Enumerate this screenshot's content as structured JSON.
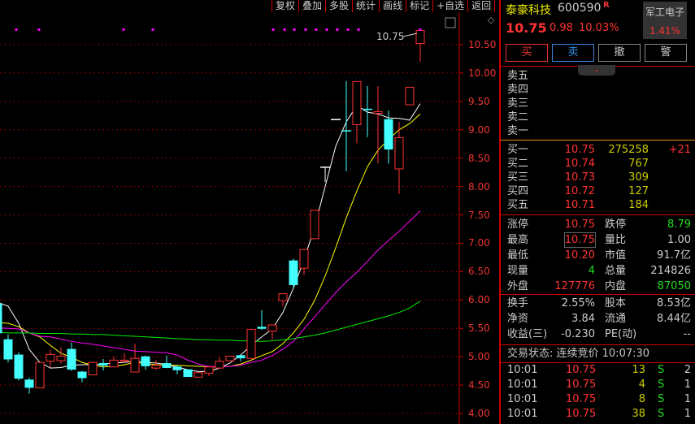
{
  "toolbar": [
    "复权",
    "叠加",
    "多股",
    "统计",
    "画线",
    "标记",
    "+自选",
    "返回"
  ],
  "stock": {
    "name": "泰豪科技",
    "code": "600590",
    "badge": "R",
    "price": "10.75",
    "change": "0.98",
    "pct": "10.03%",
    "sector": "军工电子",
    "sector_pct": "1.41%"
  },
  "trade_buttons": [
    "买",
    "卖",
    "撤",
    "警"
  ],
  "asks": [
    "卖五",
    "卖四",
    "卖三",
    "卖二",
    "卖一"
  ],
  "bids": [
    {
      "label": "买一",
      "price": "10.75",
      "vol": "275258",
      "delta": "+21"
    },
    {
      "label": "买二",
      "price": "10.74",
      "vol": "767"
    },
    {
      "label": "买三",
      "price": "10.73",
      "vol": "309"
    },
    {
      "label": "买四",
      "price": "10.72",
      "vol": "127"
    },
    {
      "label": "买五",
      "price": "10.71",
      "vol": "184"
    }
  ],
  "stats": [
    {
      "l1": "涨停",
      "v1": "10.75",
      "l2": "跌停",
      "v2": "8.79"
    },
    {
      "l1": "最高",
      "v1": "10.75",
      "l2": "量比",
      "v2": "1.00"
    },
    {
      "l1": "最低",
      "v1": "10.20",
      "l2": "市值",
      "v2": "91.7亿"
    },
    {
      "l1": "现量",
      "v1": "4",
      "l2": "总量",
      "v2": "214826"
    },
    {
      "l1": "外盘",
      "v1": "127776",
      "l2": "内盘",
      "v2": "87050"
    }
  ],
  "fund": [
    {
      "l1": "换手",
      "v1": "2.55%",
      "l2": "股本",
      "v2": "8.53亿"
    },
    {
      "l1": "净资",
      "v1": "3.84",
      "l2": "流通",
      "v2": "8.44亿"
    },
    {
      "l1": "收益(三)",
      "v1": "-0.230",
      "l2": "PE(动)",
      "v2": "--"
    }
  ],
  "status": "交易状态: 连续竞价 10:07:30",
  "ticks": [
    {
      "t": "10:01",
      "p": "10.75",
      "v": "13",
      "s": "S",
      "n": "2"
    },
    {
      "t": "10:01",
      "p": "10.75",
      "v": "4",
      "s": "S",
      "n": "1"
    },
    {
      "t": "10:01",
      "p": "10.75",
      "v": "8",
      "s": "S",
      "n": "1"
    },
    {
      "t": "10:01",
      "p": "10.75",
      "v": "38",
      "s": "S",
      "n": "1"
    }
  ],
  "chart_data": {
    "type": "candlestick",
    "last_label": "10.75",
    "y_ticks": [
      "10.50",
      "10.00",
      "9.50",
      "9.00",
      "8.50",
      "8.00",
      "7.50",
      "7.00",
      "6.50",
      "6.00",
      "5.50",
      "5.00",
      "4.50",
      "4.00"
    ],
    "ylim": [
      4.0,
      10.5
    ],
    "candles": [
      [
        5.93,
        5.96,
        5.42,
        5.42
      ],
      [
        5.3,
        5.39,
        4.9,
        4.96
      ],
      [
        5.03,
        5.08,
        4.58,
        4.62
      ],
      [
        4.59,
        4.63,
        4.35,
        4.46
      ],
      [
        4.45,
        4.9,
        4.45,
        4.9
      ],
      [
        4.92,
        5.12,
        4.81,
        5.04
      ],
      [
        4.93,
        5.17,
        4.88,
        5.01
      ],
      [
        5.13,
        5.25,
        4.75,
        4.78
      ],
      [
        4.73,
        4.75,
        4.55,
        4.63
      ],
      [
        4.68,
        4.9,
        4.68,
        4.9
      ],
      [
        4.88,
        4.96,
        4.76,
        4.85
      ],
      [
        4.82,
        5.0,
        4.82,
        4.94
      ],
      [
        4.92,
        5.06,
        4.9,
        4.94
      ],
      [
        4.73,
        5.23,
        4.73,
        4.97
      ],
      [
        5.0,
        5.02,
        4.77,
        4.84
      ],
      [
        4.8,
        4.94,
        4.77,
        4.85
      ],
      [
        4.88,
        5.02,
        4.8,
        4.81
      ],
      [
        4.82,
        4.85,
        4.69,
        4.77
      ],
      [
        4.77,
        4.77,
        4.65,
        4.65
      ],
      [
        4.64,
        4.72,
        4.64,
        4.72
      ],
      [
        4.71,
        4.84,
        4.66,
        4.82
      ],
      [
        4.8,
        4.99,
        4.8,
        4.92
      ],
      [
        4.93,
        5.01,
        4.93,
        5.01
      ],
      [
        5.02,
        5.02,
        4.92,
        4.98
      ],
      [
        4.97,
        5.48,
        4.97,
        5.48
      ],
      [
        5.52,
        5.82,
        5.47,
        5.5
      ],
      [
        5.45,
        5.57,
        5.3,
        5.56
      ],
      [
        5.99,
        6.11,
        5.89,
        6.11
      ],
      [
        6.69,
        6.73,
        6.21,
        6.27
      ],
      [
        6.56,
        6.89,
        6.44,
        6.89
      ],
      [
        7.08,
        7.58,
        7.08,
        7.58
      ],
      [
        8.34,
        8.34,
        8.08,
        8.34
      ],
      [
        9.18,
        9.18,
        9.18,
        9.18
      ],
      [
        8.98,
        9.86,
        8.27,
        8.98
      ],
      [
        9.09,
        9.85,
        8.76,
        9.85
      ],
      [
        9.36,
        9.77,
        8.87,
        9.36
      ],
      [
        9.29,
        9.77,
        8.41,
        9.32
      ],
      [
        9.18,
        9.34,
        8.4,
        8.66
      ],
      [
        8.31,
        9.14,
        7.87,
        8.86
      ],
      [
        9.44,
        9.75,
        9.44,
        9.75
      ],
      [
        10.52,
        10.75,
        10.2,
        10.75
      ]
    ],
    "series": [
      {
        "name": "MA5",
        "color": "#ffffff",
        "values": [
          5.96,
          5.89,
          5.59,
          5.13,
          4.9,
          4.8,
          4.81,
          4.85,
          4.86,
          4.86,
          4.87,
          4.89,
          4.9,
          4.92,
          4.9,
          4.89,
          4.86,
          4.82,
          4.77,
          4.74,
          4.74,
          4.8,
          4.89,
          5.03,
          5.2,
          5.35,
          5.49,
          5.78,
          6.21,
          6.71,
          7.28,
          8.0,
          8.71,
          9.14,
          9.43,
          9.31,
          9.28,
          9.21,
          9.2,
          9.17,
          9.46
        ]
      },
      {
        "name": "MA10",
        "color": "#ffff00",
        "values": [
          5.6,
          5.59,
          5.53,
          5.42,
          5.35,
          5.2,
          5.06,
          4.99,
          4.9,
          4.85,
          4.82,
          4.83,
          4.86,
          4.9,
          4.88,
          4.86,
          4.85,
          4.85,
          4.84,
          4.83,
          4.82,
          4.82,
          4.83,
          4.87,
          4.94,
          5.02,
          5.09,
          5.23,
          5.42,
          5.66,
          5.99,
          6.42,
          6.92,
          7.45,
          7.92,
          8.35,
          8.64,
          8.83,
          9.0,
          9.11,
          9.28
        ]
      },
      {
        "name": "MA20",
        "color": "#ff00ff",
        "values": [
          5.51,
          5.5,
          5.49,
          5.42,
          5.36,
          5.35,
          5.31,
          5.27,
          5.24,
          5.22,
          5.19,
          5.16,
          5.13,
          5.1,
          5.09,
          5.08,
          5.07,
          5.03,
          4.94,
          4.87,
          4.83,
          4.82,
          4.83,
          4.85,
          4.9,
          4.94,
          5.02,
          5.13,
          5.27,
          5.49,
          5.7,
          5.92,
          6.13,
          6.32,
          6.49,
          6.68,
          6.88,
          7.05,
          7.21,
          7.39,
          7.57
        ]
      },
      {
        "name": "MA60",
        "color": "#00ee00",
        "values": [
          5.43,
          5.42,
          5.42,
          5.42,
          5.41,
          5.41,
          5.41,
          5.4,
          5.4,
          5.39,
          5.39,
          5.38,
          5.37,
          5.36,
          5.35,
          5.34,
          5.33,
          5.32,
          5.31,
          5.3,
          5.3,
          5.29,
          5.29,
          5.28,
          5.28,
          5.27,
          5.28,
          5.3,
          5.32,
          5.35,
          5.38,
          5.42,
          5.47,
          5.52,
          5.57,
          5.62,
          5.67,
          5.72,
          5.78,
          5.86,
          5.98
        ]
      }
    ]
  }
}
